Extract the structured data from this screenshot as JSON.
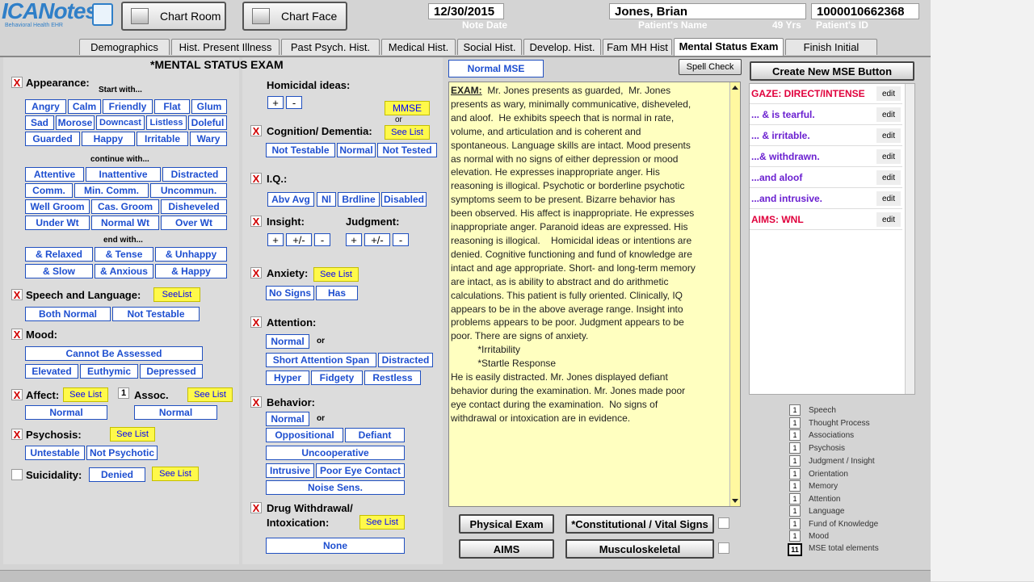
{
  "app": {
    "logo": "ICANotes",
    "logo_sub": "Behavioral Health EHR"
  },
  "header": {
    "chart_room": "Chart Room",
    "chart_face": "Chart Face",
    "note_date": "12/30/2015",
    "note_date_label": "Note Date",
    "patient_name": "Jones, Brian",
    "patient_name_label": "Patient's Name",
    "age": "49 Yrs",
    "patient_id": "1000010662368",
    "patient_id_label": "Patient's ID"
  },
  "tabs": [
    "Demographics",
    "Hist. Present Illness",
    "Past Psych. Hist.",
    "Medical Hist.",
    "Social Hist.",
    "Develop. Hist.",
    "Fam MH Hist",
    "Mental Status Exam",
    "Finish Initial"
  ],
  "section_title": "*MENTAL STATUS EXAM",
  "appearance": {
    "label": "Appearance:",
    "start": "Start with...",
    "continue": "continue with...",
    "end": "end with...",
    "row1": [
      "Angry",
      "Calm",
      "Friendly",
      "Flat",
      "Glum"
    ],
    "row2": [
      "Sad",
      "Morose",
      "Downcast",
      "Listless",
      "Doleful"
    ],
    "row3": [
      "Guarded",
      "Happy",
      "Irritable",
      "Wary"
    ],
    "c1": [
      "Attentive",
      "Inattentive",
      "Distracted"
    ],
    "c2": [
      "Comm.",
      "Min. Comm.",
      "Uncommun."
    ],
    "c3": [
      "Well Groom",
      "Cas. Groom",
      "Disheveled"
    ],
    "c4": [
      "Under Wt",
      "Normal Wt",
      "Over Wt"
    ],
    "e1": [
      "& Relaxed",
      "& Tense",
      "& Unhappy"
    ],
    "e2": [
      "& Slow",
      "& Anxious",
      "& Happy"
    ]
  },
  "speech": {
    "label": "Speech and Language:",
    "see": "SeeList",
    "opts": [
      "Both Normal",
      "Not Testable"
    ]
  },
  "mood": {
    "label": "Mood:",
    "cannot": "Cannot Be Assessed",
    "opts": [
      "Elevated",
      "Euthymic",
      "Depressed"
    ]
  },
  "affect": {
    "label": "Affect:",
    "see": "See List",
    "normal": "Normal"
  },
  "assoc": {
    "num": "1",
    "label": "Assoc.",
    "see": "See List",
    "normal": "Normal"
  },
  "psychosis": {
    "label": "Psychosis:",
    "see": "See List",
    "opts": [
      "Untestable",
      "Not Psychotic"
    ]
  },
  "suicidality": {
    "label": "Suicidality:",
    "denied": "Denied",
    "see": "See List"
  },
  "homicidal": {
    "label": "Homicidal ideas:",
    "plus": "+",
    "minus": "-"
  },
  "mmse": {
    "label": "MMSE",
    "or": "or"
  },
  "cognition": {
    "label": "Cognition/ Dementia:",
    "see": "See List",
    "opts": [
      "Not Testable",
      "Normal",
      "Not Tested"
    ]
  },
  "iq": {
    "label": "I.Q.:",
    "opts": [
      "Abv Avg",
      "Nl",
      "Brdline",
      "Disabled"
    ]
  },
  "insight": {
    "label": "Insight:",
    "judgment": "Judgment:",
    "plus": "+",
    "pm": "+/-",
    "minus": "-"
  },
  "anxiety": {
    "label": "Anxiety:",
    "see": "See List",
    "opts": [
      "No Signs",
      "Has"
    ]
  },
  "attention": {
    "label": "Attention:",
    "normal": "Normal",
    "or": "or",
    "r1": [
      "Short Attention Span",
      "Distracted"
    ],
    "r2": [
      "Hyper",
      "Fidgety",
      "Restless"
    ]
  },
  "behavior": {
    "label": "Behavior:",
    "normal": "Normal",
    "or": "or",
    "r1": [
      "Oppositional",
      "Defiant"
    ],
    "uncoop": "Uncooperative",
    "r2": [
      "Intrusive",
      "Poor Eye Contact"
    ],
    "noise": "Noise Sens."
  },
  "drug": {
    "label1": "Drug Withdrawal/",
    "label2": "Intoxication:",
    "see": "See List",
    "none": "None"
  },
  "normal_mse": "Normal MSE",
  "spell_check": "Spell Check",
  "exam": {
    "heading": "EXAM:",
    "text": "  Mr. Jones presents as guarded,  Mr. Jones\npresents as wary, minimally communicative, disheveled,\nand aloof.  He exhibits speech that is normal in rate,\nvolume, and articulation and is coherent and\nspontaneous. Language skills are intact. Mood presents\nas normal with no signs of either depression or mood\nelevation. He expresses inappropriate anger. His\nreasoning is illogical. Psychotic or borderline psychotic\nsymptoms seem to be present. Bizarre behavior has\nbeen observed. His affect is inappropriate. He expresses\ninappropriate anger. Paranoid ideas are expressed. His\nreasoning is illogical.    Homicidal ideas or intentions are\ndenied. Cognitive functioning and fund of knowledge are\nintact and age appropriate. Short- and long-term memory\nare intact, as is ability to abstract and do arithmetic\ncalculations. This patient is fully oriented. Clinically, IQ\nappears to be in the above average range. Insight into\nproblems appears to be poor. Judgment appears to be\npoor. There are signs of anxiety.\n          *Irritability\n          *Startle Response\nHe is easily distracted. Mr. Jones displayed defiant\nbehavior during the examination. Mr. Jones made poor\neye contact during the examination.  No signs of\nwithdrawal or intoxication are in evidence."
  },
  "create_btn": "Create New MSE Button",
  "mse_buttons": [
    {
      "label": "GAZE: DIRECT/INTENSE",
      "color": "#e0003c"
    },
    {
      "label": "... & is tearful.",
      "color": "#6a1fd0"
    },
    {
      "label": "... & irritable.",
      "color": "#6a1fd0"
    },
    {
      "label": "...& withdrawn.",
      "color": "#6a1fd0"
    },
    {
      "label": "...and aloof",
      "color": "#6a1fd0"
    },
    {
      "label": "...and intrusive.",
      "color": "#6a1fd0"
    },
    {
      "label": "AIMS: WNL",
      "color": "#e0003c"
    }
  ],
  "edit": "edit",
  "bottom_btns": {
    "physical": "Physical Exam",
    "constitutional": "*Constitutional / Vital Signs",
    "aims": "AIMS",
    "musculo": "Musculoskeletal"
  },
  "counts": [
    {
      "n": "1",
      "label": "Speech"
    },
    {
      "n": "1",
      "label": "Thought Process"
    },
    {
      "n": "1",
      "label": "Associations"
    },
    {
      "n": "1",
      "label": "Psychosis"
    },
    {
      "n": "1",
      "label": "Judgment / Insight"
    },
    {
      "n": "1",
      "label": "Orientation"
    },
    {
      "n": "1",
      "label": "Memory"
    },
    {
      "n": "1",
      "label": "Attention"
    },
    {
      "n": "1",
      "label": "Language"
    },
    {
      "n": "1",
      "label": "Fund of Knowledge"
    },
    {
      "n": "1",
      "label": "Mood"
    }
  ],
  "total": {
    "n": "11",
    "label": "MSE total elements"
  }
}
